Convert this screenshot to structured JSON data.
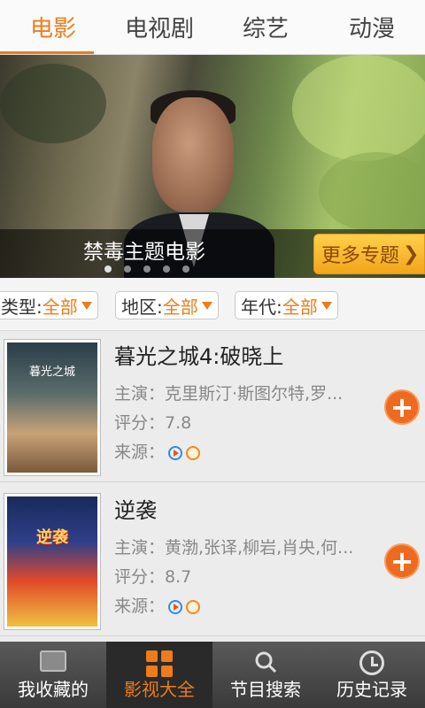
{
  "top_tabs": [
    {
      "label": "电影",
      "active": true
    },
    {
      "label": "电视剧",
      "active": false
    },
    {
      "label": "综艺",
      "active": false
    },
    {
      "label": "动漫",
      "active": false
    }
  ],
  "banner": {
    "caption": "禁毒主题电影",
    "more_label": "更多专题",
    "more_arrow": "❯",
    "dots": 5,
    "active_dot": 0
  },
  "filters": [
    {
      "label": "类型:",
      "value": "全部"
    },
    {
      "label": "地区:",
      "value": "全部"
    },
    {
      "label": "年代:",
      "value": "全部"
    }
  ],
  "movies": [
    {
      "title": "暮光之城4:破晓上",
      "cast_label": "主演：",
      "cast": "克里斯汀·斯图尔特,罗...",
      "rating_label": "评分：",
      "rating": "7.8",
      "source_label": "来源：",
      "poster_text": "暮光之城"
    },
    {
      "title": "逆袭",
      "cast_label": "主演：",
      "cast": "黄渤,张译,柳岩,肖央,何...",
      "rating_label": "评分：",
      "rating": "8.7",
      "source_label": "来源：",
      "poster_text": "逆袭"
    }
  ],
  "bottom_nav": [
    {
      "label": "我收藏的",
      "icon": "folder-icon",
      "active": false
    },
    {
      "label": "影视大全",
      "icon": "grid-icon",
      "active": true
    },
    {
      "label": "节目搜索",
      "icon": "search-icon",
      "active": false
    },
    {
      "label": "历史记录",
      "icon": "clock-icon",
      "active": false
    }
  ],
  "colors": {
    "accent": "#ee7c1a",
    "nav_bg": "#3a3a3a"
  }
}
